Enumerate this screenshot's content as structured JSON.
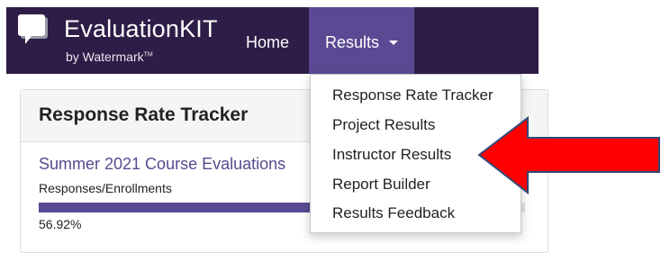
{
  "brand": {
    "name": "EvaluationKIT",
    "sub": "by Watermark",
    "tm": "TM",
    "logo_icon": "speech-bubble-icon"
  },
  "nav": {
    "home_label": "Home",
    "results_label": "Results",
    "results_caret_icon": "caret-down-icon"
  },
  "panel": {
    "title": "Response Rate Tracker",
    "course_link": "Summer 2021 Course Evaluations",
    "responses_label": "Responses/Enrollments",
    "progress_percent": 56.92,
    "progress_text": "56.92%"
  },
  "dropdown": {
    "items": [
      "Response Rate Tracker",
      "Project Results",
      "Instructor Results",
      "Report Builder",
      "Results Feedback"
    ]
  },
  "annotation": {
    "arrow_icon": "red-arrow-icon",
    "arrow_color": "#ff0000",
    "arrow_outline": "#2f4a7a"
  },
  "colors": {
    "navbar_bg": "#2e1d47",
    "nav_active_bg": "#5a4a93",
    "link": "#574a8f"
  }
}
